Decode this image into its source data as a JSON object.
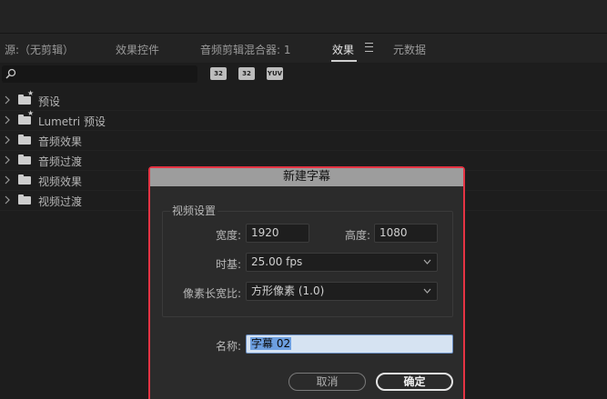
{
  "tabs": [
    {
      "label": "源:（无剪辑）"
    },
    {
      "label": "效果控件"
    },
    {
      "label": "音频剪辑混合器: 1"
    },
    {
      "label": "效果"
    },
    {
      "label": "元数据"
    }
  ],
  "toolbar": {
    "icons": [
      "accelerated-effects-icon",
      "32-bit-icon",
      "yuv-icon"
    ],
    "icon_labels": [
      "32",
      "32",
      "YUV"
    ]
  },
  "tree": [
    {
      "label": "预设",
      "icon": "preset-folder-icon"
    },
    {
      "label": "Lumetri 预设",
      "icon": "preset-folder-icon"
    },
    {
      "label": "音频效果",
      "icon": "folder-icon"
    },
    {
      "label": "音频过渡",
      "icon": "folder-icon"
    },
    {
      "label": "视频效果",
      "icon": "folder-icon"
    },
    {
      "label": "视频过渡",
      "icon": "folder-icon"
    }
  ],
  "dialog": {
    "title": "新建字幕",
    "group_title": "视频设置",
    "width_label": "宽度:",
    "width_value": "1920",
    "height_label": "高度:",
    "height_value": "1080",
    "timebase_label": "时基:",
    "timebase_value": "25.00 fps",
    "par_label": "像素长宽比:",
    "par_value": "方形像素 (1.0)",
    "name_label": "名称:",
    "name_value": "字幕 02",
    "cancel_label": "取消",
    "ok_label": "确定"
  },
  "colors": {
    "highlight_border": "#e53343",
    "title_bar": "#9d9d9d",
    "name_selection": "#6d9fe0"
  }
}
